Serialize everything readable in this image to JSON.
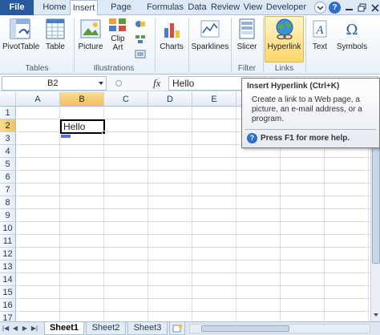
{
  "tabs": [
    {
      "label": "File"
    },
    {
      "label": "Home"
    },
    {
      "label": "Insert"
    },
    {
      "label": "Page Layout"
    },
    {
      "label": "Formulas"
    },
    {
      "label": "Data"
    },
    {
      "label": "Review"
    },
    {
      "label": "View"
    },
    {
      "label": "Developer"
    }
  ],
  "ribbon": {
    "pivottable": "PivotTable",
    "table": "Table",
    "picture": "Picture",
    "clipart_line1": "Clip",
    "clipart_line2": "Art",
    "charts": "Charts",
    "sparklines": "Sparklines",
    "slicer": "Slicer",
    "hyperlink": "Hyperlink",
    "text": "Text",
    "symbols": "Symbols",
    "groups": {
      "tables": "Tables",
      "illustrations": "Illustrations",
      "filter": "Filter",
      "links": "Links"
    }
  },
  "formula_bar": {
    "name_box": "B2",
    "fx": "fx",
    "content": "Hello"
  },
  "columns": [
    "A",
    "B",
    "C",
    "D",
    "E"
  ],
  "rows": [
    "1",
    "2",
    "3",
    "4",
    "5",
    "6",
    "7",
    "8",
    "9",
    "10",
    "11",
    "12",
    "13",
    "14",
    "15",
    "16",
    "17"
  ],
  "cell_b2": "Hello",
  "sheets": [
    {
      "label": "Sheet1"
    },
    {
      "label": "Sheet2"
    },
    {
      "label": "Sheet3"
    }
  ],
  "tooltip": {
    "title": "Insert Hyperlink (Ctrl+K)",
    "desc_lines": [
      "Create a link to a Web page, a",
      "picture, an e-mail address, or a",
      "program."
    ],
    "help": "Press F1 for more help."
  },
  "colors": {
    "file_tab": "#2a5a9e",
    "selection_header": "#f1c15f",
    "hyperlink_highlight": "#ffd66b"
  }
}
